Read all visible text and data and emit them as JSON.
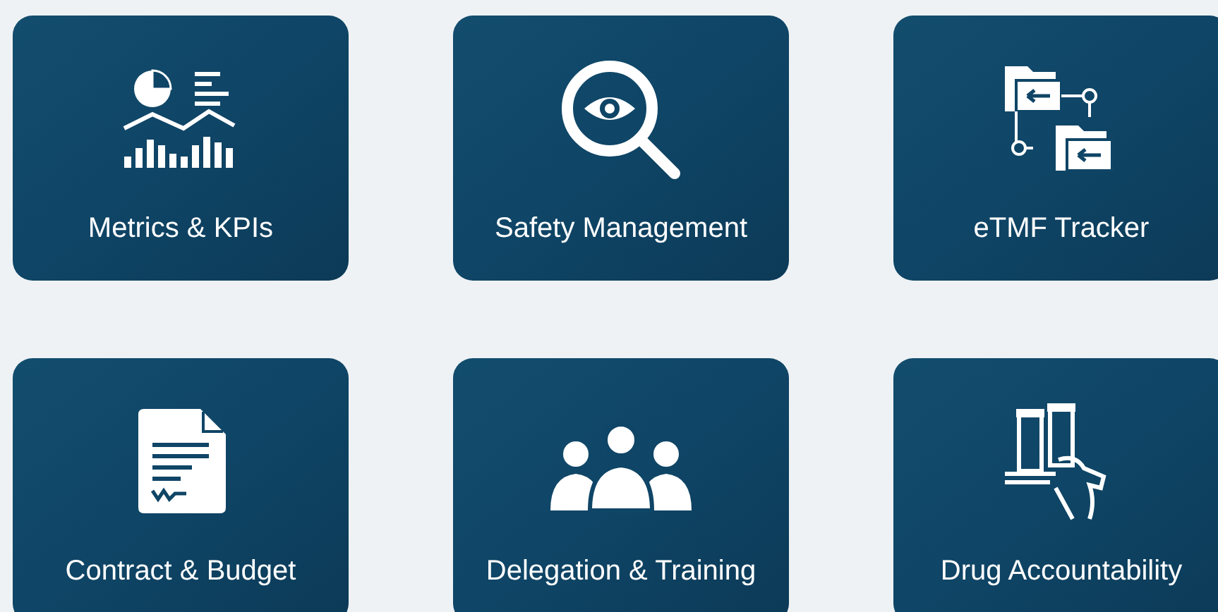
{
  "tiles": [
    {
      "label": "Metrics & KPIs"
    },
    {
      "label": "Safety Management"
    },
    {
      "label": "eTMF Tracker"
    },
    {
      "label": "Contract & Budget"
    },
    {
      "label": "Delegation & Training"
    },
    {
      "label": "Drug Accountability"
    }
  ]
}
